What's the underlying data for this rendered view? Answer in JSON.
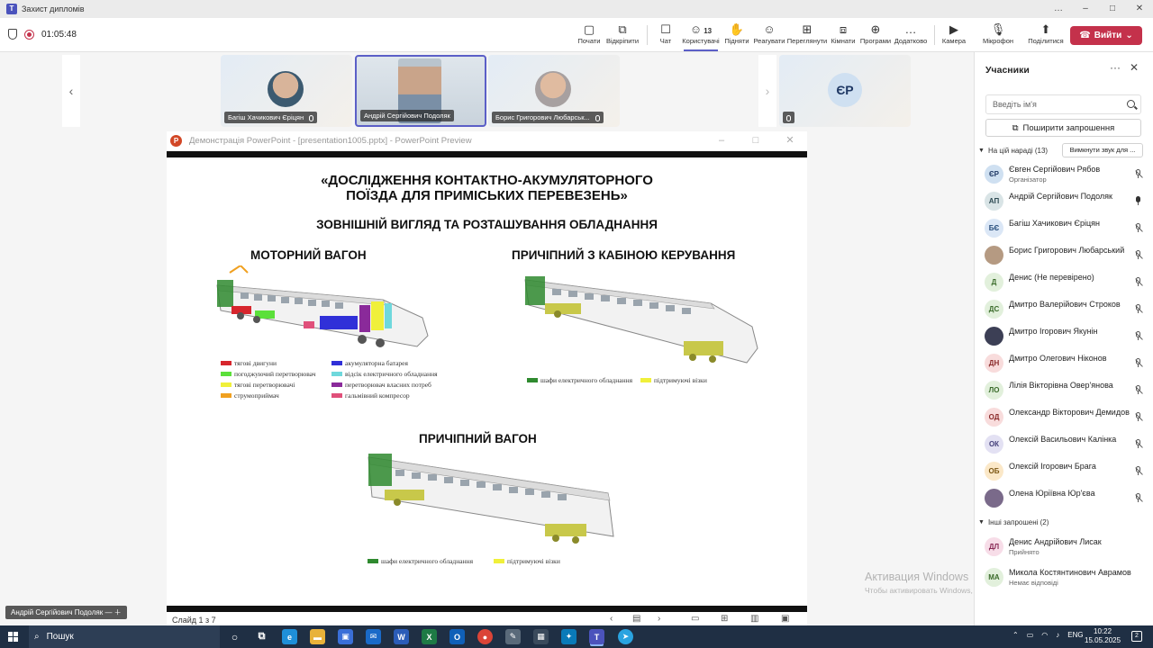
{
  "window": {
    "title": "Захист дипломів",
    "controls": [
      "…",
      "–",
      "□",
      "✕"
    ]
  },
  "toolbar": {
    "timer": "01:05:48",
    "buttons": [
      {
        "label": "Почати",
        "icon": "▢"
      },
      {
        "label": "Відкріпити",
        "icon": "⧉"
      },
      {
        "label": "Чат",
        "icon": "☐"
      },
      {
        "label": "Користувачі",
        "icon": "☺",
        "count": "13"
      },
      {
        "label": "Підняти",
        "icon": "✋"
      },
      {
        "label": "Реагувати",
        "icon": "☺"
      },
      {
        "label": "Переглянути",
        "icon": "⊞"
      },
      {
        "label": "Кімнати",
        "icon": "⧈"
      },
      {
        "label": "Програми",
        "icon": "⊕"
      },
      {
        "label": "Додатково",
        "icon": "…"
      },
      {
        "label": "Камера",
        "icon": "▶"
      },
      {
        "label": "Мікрофон",
        "icon": "🎙"
      },
      {
        "label": "Поділитися",
        "icon": "⬆"
      }
    ],
    "leave_label": "Вийти"
  },
  "tiles": [
    {
      "name": "Багіш Хачикович Єріцян"
    },
    {
      "name": "Андрій Сергійович Подоляк"
    },
    {
      "name": "Борис Григорович Любарськ..."
    },
    {
      "initials": "ЄР"
    }
  ],
  "ppt": {
    "title": "Демонстрація PowerPoint - [presentation1005.pptx] - PowerPoint Preview",
    "slide": {
      "title_line1": "«ДОСЛІДЖЕННЯ КОНТАКТНО-АКУМУЛЯТОРНОГО",
      "title_line2": "ПОЇЗДА ДЛЯ ПРИМІСЬКИХ ПЕРЕВЕЗЕНЬ»",
      "subtitle": "ЗОВНІШНІЙ ВИГЛЯД ТА РОЗТАШУВАННЯ ОБЛАДНАННЯ",
      "motor_heading": "МОТОРНИЙ ВАГОН",
      "cab_heading": "ПРИЧІПНИЙ З КАБІНОЮ КЕРУВАННЯ",
      "trailer_heading": "ПРИЧІПНИЙ ВАГОН",
      "motor_legend": [
        {
          "label": "тягові двигуни",
          "color": "#d7262d"
        },
        {
          "label": "погоджуючий перетворювач",
          "color": "#5be03a"
        },
        {
          "label": "тягові перетворювачі",
          "color": "#f0f03a"
        },
        {
          "label": "струмоприймач",
          "color": "#f0a020"
        },
        {
          "label": "акумуляторна батарея",
          "color": "#3030d8"
        },
        {
          "label": "відсік електричного обладнання",
          "color": "#6fd8dc"
        },
        {
          "label": "перетворювач власних потреб",
          "color": "#8a2a9a"
        },
        {
          "label": "гальмівний компресор",
          "color": "#e0507a"
        }
      ],
      "cab_legend": [
        {
          "label": "шафи електричного обладнання",
          "color": "#2f8a2f"
        },
        {
          "label": "підтримуючі візки",
          "color": "#f0f03a"
        }
      ],
      "trailer_legend": [
        {
          "label": "шафи електричного обладнання",
          "color": "#2f8a2f"
        },
        {
          "label": "підтримуючі візки",
          "color": "#f0f03a"
        }
      ]
    },
    "status": {
      "slide_counter": "Слайд 1 з 7"
    }
  },
  "speaker_chip": "Андрій Сергійович Подоляк",
  "watermark": {
    "line1": "Активация Windows",
    "line2": "Чтобы активировать Windows, перейдите в раздел \"Параметры\"."
  },
  "panel": {
    "title": "Учасники",
    "search_placeholder": "Введіть ім'я",
    "share_label": "Поширити запрошення",
    "in_meeting_label": "На цій нараді (13)",
    "mute_all_label": "Вимкнути звук для ...",
    "participants": [
      {
        "initials": "ЄР",
        "name": "Євген Сергійович Рябов",
        "role": "Організатор",
        "bg": "#cfe0f1",
        "fg": "#1f3864",
        "mic": "off"
      },
      {
        "initials": "АП",
        "name": "Андрій Сергійович Подоляк",
        "role": "",
        "bg": "#d9e4e6",
        "fg": "#2d4a52",
        "mic": "on"
      },
      {
        "initials": "БЄ",
        "name": "Багіш Хачикович Єріцян",
        "role": "",
        "bg": "#dbe7f6",
        "fg": "#244b7a",
        "mic": "off"
      },
      {
        "initials": "",
        "name": "Борис Григорович Любарський",
        "role": "",
        "bg": "#b59a82",
        "fg": "#fff",
        "mic": "off"
      },
      {
        "initials": "Д",
        "name": "Денис (Не перевірено)",
        "role": "",
        "bg": "#e2f0dc",
        "fg": "#3a6b2a",
        "mic": "off"
      },
      {
        "initials": "ДС",
        "name": "Дмитро Валерійович Строков",
        "role": "",
        "bg": "#e2f0dc",
        "fg": "#3a6b2a",
        "mic": "off"
      },
      {
        "initials": "",
        "name": "Дмитро Ігорович Якунін",
        "role": "",
        "bg": "#3c3f55",
        "fg": "#fff",
        "mic": "off"
      },
      {
        "initials": "ДН",
        "name": "Дмитро Олегович Ніконов",
        "role": "",
        "bg": "#f8dcdc",
        "fg": "#8a2a2a",
        "mic": "off"
      },
      {
        "initials": "ЛО",
        "name": "Лілія Вікторівна Овер'янова",
        "role": "",
        "bg": "#e2f0dc",
        "fg": "#3a6b2a",
        "mic": "off"
      },
      {
        "initials": "ОД",
        "name": "Олександр Вікторович Демидов",
        "role": "",
        "bg": "#f8dcdc",
        "fg": "#8a2a2a",
        "mic": "off"
      },
      {
        "initials": "ОК",
        "name": "Олексій Васильович Калінка",
        "role": "",
        "bg": "#e3e1f3",
        "fg": "#45407a",
        "mic": "off"
      },
      {
        "initials": "ОБ",
        "name": "Олексій Ігорович Брага",
        "role": "",
        "bg": "#fbe8c8",
        "fg": "#7a5410",
        "mic": "off"
      },
      {
        "initials": "",
        "name": "Олена Юріївна Юр'єва",
        "role": "",
        "bg": "#7a6a8a",
        "fg": "#fff",
        "mic": "off"
      }
    ],
    "invited_label": "Інші запрошені (2)",
    "invited": [
      {
        "initials": "ДЛ",
        "name": "Денис Андрійович Лисак",
        "role": "Прийнято",
        "bg": "#f7dde8",
        "fg": "#8a2a56"
      },
      {
        "initials": "МА",
        "name": "Микола Костянтинович Аврамов",
        "role": "Немає відповіді",
        "bg": "#e2f0dc",
        "fg": "#3a6b2a"
      }
    ]
  },
  "taskbar": {
    "search_label": "Пошук",
    "tray_lang": "ENG",
    "time": "10:22",
    "date": "15.05.2025",
    "notif_count": "2"
  }
}
